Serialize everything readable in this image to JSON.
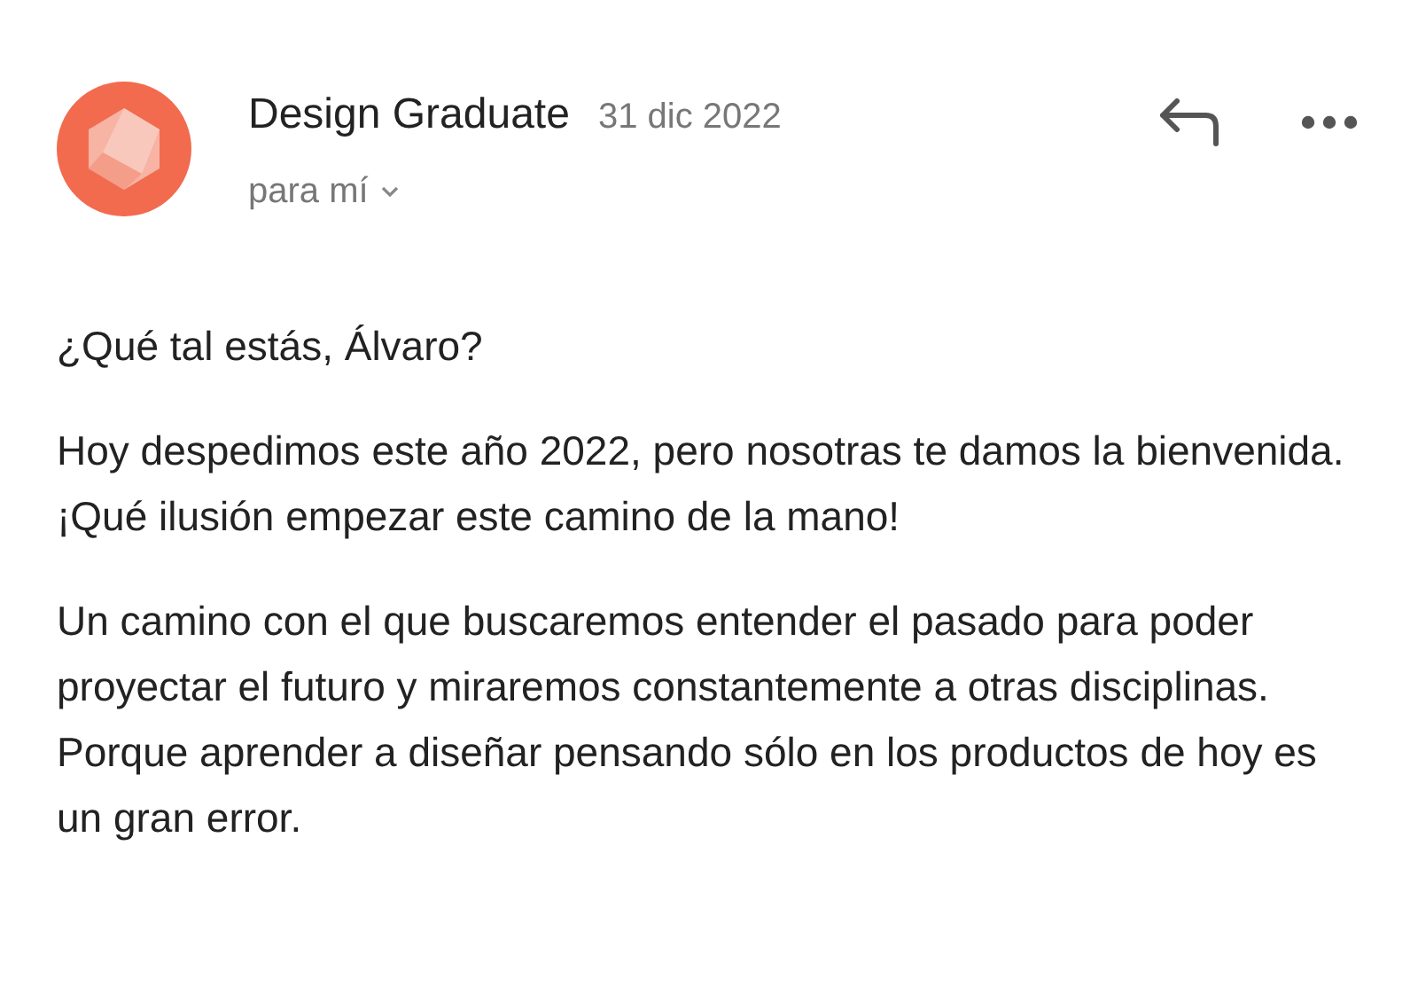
{
  "sender": {
    "name": "Design Graduate",
    "date": "31 dic 2022",
    "recipient": "para mí"
  },
  "body": [
    {
      "lines": [
        "¿Qué tal estás, Álvaro?"
      ]
    },
    {
      "lines": [
        "Hoy despedimos este año 2022, pero nosotras te damos la bienvenida.",
        "¡Qué ilusión empezar este camino de la mano!"
      ]
    },
    {
      "lines": [
        "Un camino con el que buscaremos entender el pasado para poder proyectar el futuro y miraremos constantemente a otras disciplinas. Porque aprender a diseñar pensando sólo en los productos de hoy es un gran error."
      ]
    }
  ]
}
